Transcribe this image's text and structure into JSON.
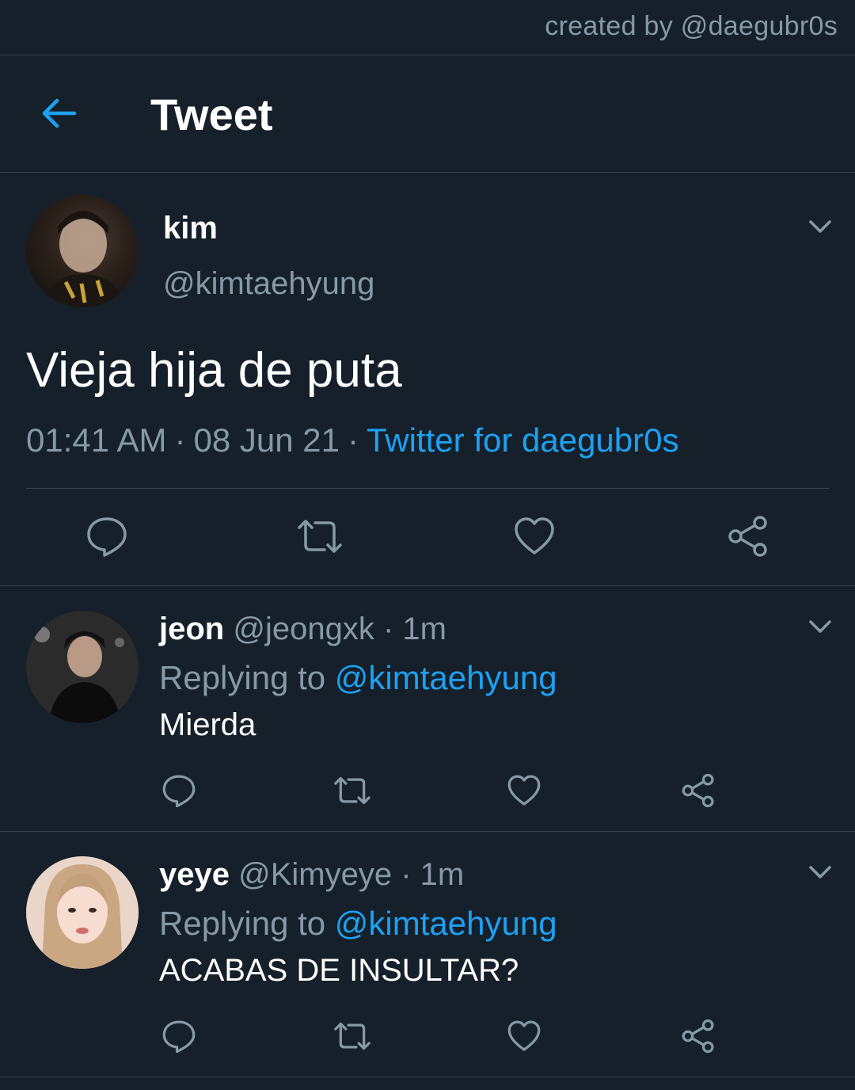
{
  "credit": "created by @daegubr0s",
  "header": {
    "title": "Tweet"
  },
  "tweet": {
    "name": "kim",
    "handle": "@kimtaehyung",
    "text": "Vieja hija de puta",
    "time": "01:41 AM",
    "date": "08 Jun 21",
    "client": "Twitter for daegubr0s"
  },
  "replies": [
    {
      "name": "jeon",
      "handle": "@jeongxk",
      "time": "1m",
      "replying_label": "Replying to",
      "replying_handle": "@kimtaehyung",
      "text": "Mierda"
    },
    {
      "name": "yeye",
      "handle": "@Kimyeye",
      "time": "1m",
      "replying_label": "Replying to",
      "replying_handle": "@kimtaehyung",
      "text": "ACABAS DE INSULTAR?"
    }
  ],
  "icons": {
    "back": "back-arrow-icon",
    "menu": "chevron-down-icon",
    "reply": "reply-icon",
    "retweet": "retweet-icon",
    "like": "heart-icon",
    "share": "share-icon"
  },
  "colors": {
    "background": "#15202b",
    "accent": "#1da1f2",
    "secondary_text": "#8899a6",
    "divider": "#38444d"
  }
}
